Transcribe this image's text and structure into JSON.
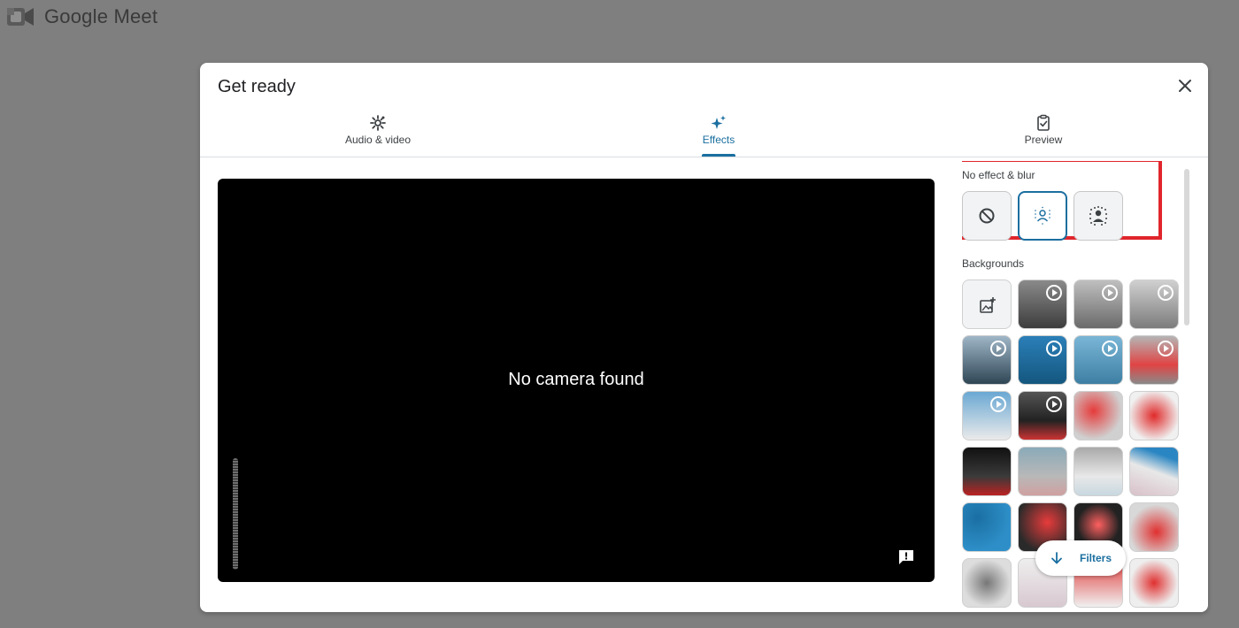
{
  "app": {
    "title": "Google Meet"
  },
  "dialog": {
    "title": "Get ready",
    "tabs": [
      {
        "label": "Audio & video",
        "icon": "gear-icon"
      },
      {
        "label": "Effects",
        "icon": "sparkle-icon",
        "active": true
      },
      {
        "label": "Preview",
        "icon": "clipboard-check-icon"
      }
    ]
  },
  "video": {
    "status": "No camera found"
  },
  "effects": {
    "no_effect_label": "No effect & blur",
    "backgrounds_label": "Backgrounds",
    "filters_label": "Filters"
  },
  "colors": {
    "accent": "#1b6fa0",
    "highlight": "#e0262c",
    "overlay": "#7f7f7f"
  }
}
